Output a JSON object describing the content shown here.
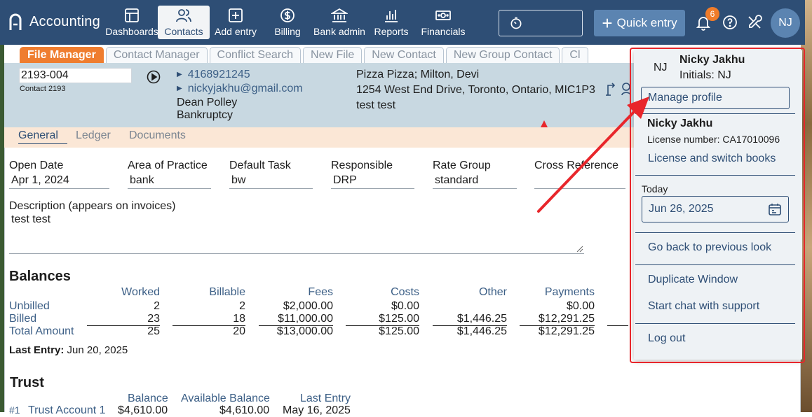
{
  "app": {
    "title": "Accounting"
  },
  "nav": [
    {
      "label": "Dashboards",
      "icon": "dashboard-icon"
    },
    {
      "label": "Contacts",
      "icon": "contacts-icon",
      "active": true
    },
    {
      "label": "Add entry",
      "icon": "add-entry-icon"
    },
    {
      "label": "Billing",
      "icon": "billing-icon"
    },
    {
      "label": "Bank admin",
      "icon": "bank-icon"
    },
    {
      "label": "Reports",
      "icon": "reports-icon"
    },
    {
      "label": "Financials",
      "icon": "financials-icon"
    }
  ],
  "toolbar": {
    "quick_entry_label": "Quick entry",
    "notification_count": "6",
    "avatar_initials": "NJ"
  },
  "subtabs": [
    "File Manager",
    "Contact Manager",
    "Conflict Search",
    "New File",
    "New Contact",
    "New Group Contact",
    "Cl"
  ],
  "contact": {
    "file_number": "2193-004",
    "contact_label": "Contact 2193",
    "phone": "4168921245",
    "email": "nickyjakhu@gmail.com",
    "name": "Dean Polley",
    "matter": "Bankruptcy",
    "client_line": "Pizza Pizza; Milton, Devi",
    "address": "1254 West End Drive, Toronto, Ontario, MIC1P3",
    "note": "test test"
  },
  "section_tabs": [
    "General",
    "Ledger",
    "Documents"
  ],
  "fields": [
    {
      "label": "Open Date",
      "value": "Apr 1, 2024"
    },
    {
      "label": "Area of Practice",
      "value": "bank"
    },
    {
      "label": "Default Task",
      "value": "bw"
    },
    {
      "label": "Responsible",
      "value": "DRP"
    },
    {
      "label": "Rate Group",
      "value": "standard"
    },
    {
      "label": "Cross Reference",
      "value": ""
    }
  ],
  "description": {
    "label": "Description (appears on invoices)",
    "value": "test test"
  },
  "balances": {
    "title": "Balances",
    "columns": [
      "Worked",
      "Billable",
      "Fees",
      "Costs",
      "Other",
      "Payments"
    ],
    "rows": [
      {
        "label": "Unbilled",
        "values": [
          "2",
          "2",
          "$2,000.00",
          "$0.00",
          "",
          "$0.00"
        ]
      },
      {
        "label": "Billed",
        "values": [
          "23",
          "18",
          "$11,000.00",
          "$125.00",
          "$1,446.25",
          "$12,291.25"
        ]
      },
      {
        "label": "Total Amount",
        "values": [
          "25",
          "20",
          "$13,000.00",
          "$125.00",
          "$1,446.25",
          "$12,291.25"
        ]
      }
    ],
    "last_entry_label": "Last Entry:",
    "last_entry_value": "Jun 20, 2025"
  },
  "trust": {
    "title": "Trust",
    "columns": [
      "Balance",
      "Available Balance",
      "Last Entry"
    ],
    "row": {
      "num": "#1",
      "account": "Trust Account 1",
      "balance": "$4,610.00",
      "available": "$4,610.00",
      "last_entry": "May 16, 2025"
    }
  },
  "profile_menu": {
    "initials": "NJ",
    "name": "Nicky Jakhu",
    "initials_line": "Initials: NJ",
    "manage_profile": "Manage profile",
    "license_name": "Nicky Jakhu",
    "license_number": "License number: CA17010096",
    "license_switch": "License and switch books",
    "today_label": "Today",
    "today_value": "Jun 26, 2025",
    "go_back": "Go back to previous look",
    "duplicate": "Duplicate Window",
    "chat": "Start chat with support",
    "logout": "Log out"
  },
  "colors": {
    "topbar": "#2e4e75",
    "accent_orange": "#ef7d2f",
    "highlight_red": "#e8262b",
    "band_blue": "#c8d8e1"
  }
}
